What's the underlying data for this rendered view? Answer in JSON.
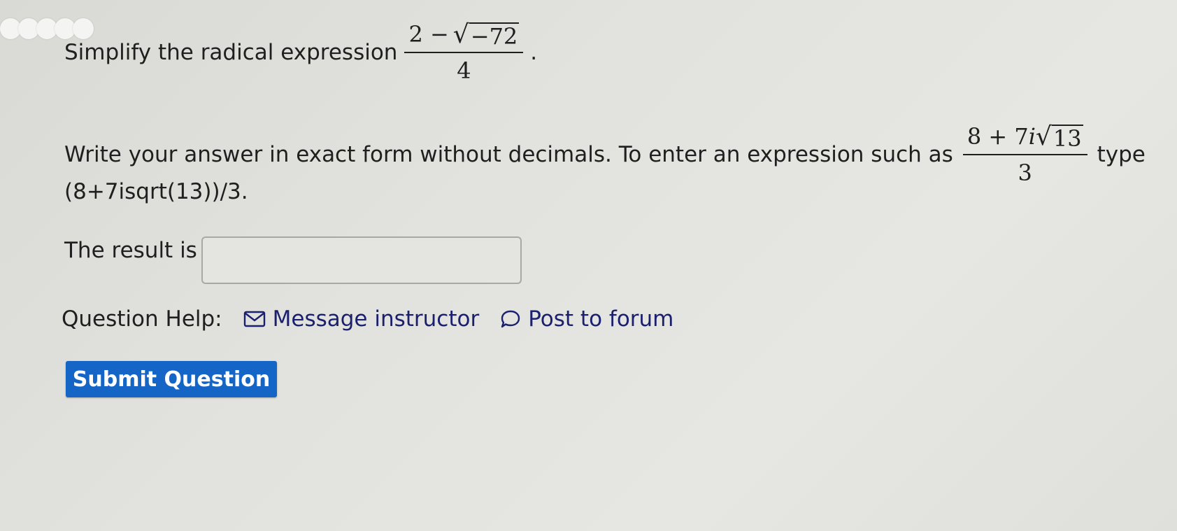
{
  "question": {
    "intro": "Simplify the radical expression",
    "expr": {
      "num_prefix": "2 −",
      "radicand": "−72",
      "den": "4"
    },
    "trailing_period": ".",
    "instructions": "Write your answer in exact form without decimals. To enter an expression such as",
    "example": {
      "num_prefix": "8 + 7",
      "num_i": "i",
      "radicand": "13",
      "den": "3"
    },
    "type_word": "type",
    "example_text": "(8+7isqrt(13))/3."
  },
  "answer": {
    "label": "The result is",
    "value": "",
    "placeholder": ""
  },
  "help": {
    "label": "Question Help:",
    "message_label": "Message instructor",
    "forum_label": "Post to forum"
  },
  "submit_label": "Submit Question",
  "colors": {
    "link": "#1a1f6e",
    "submit_bg": "#1565c6"
  }
}
